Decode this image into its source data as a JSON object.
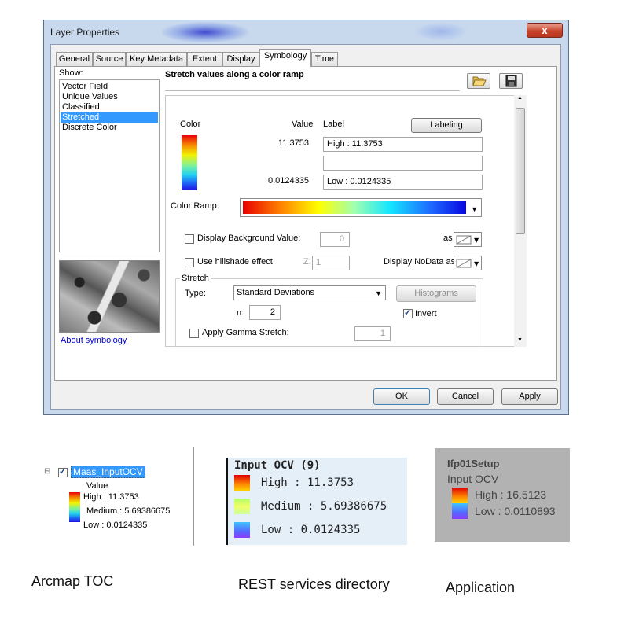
{
  "dialog": {
    "title": "Layer Properties",
    "close_glyph": "x",
    "tabs": [
      "General",
      "Source",
      "Key Metadata",
      "Extent",
      "Display",
      "Symbology",
      "Time"
    ],
    "active_tab": "Symbology",
    "show_label": "Show:",
    "show_items": [
      "Vector Field",
      "Unique Values",
      "Classified",
      "Stretched",
      "Discrete Color"
    ],
    "selected_show_item": "Stretched",
    "about_link": "About symbology",
    "subheading": "Stretch values along a color ramp",
    "columns": {
      "color": "Color",
      "value": "Value",
      "label": "Label"
    },
    "labeling_button": "Labeling",
    "high_value": "11.3753",
    "high_label": "High : 11.3753",
    "mid_label": "",
    "low_value": "0.0124335",
    "low_label": "Low : 0.0124335",
    "color_ramp_label": "Color Ramp:",
    "display_background_label": "Display Background Value:",
    "display_background_value": "0",
    "as_label": "as",
    "hillshade_label": "Use hillshade effect",
    "z_label": "Z:",
    "z_value": "1",
    "nodata_label": "Display NoData as",
    "stretch_group": "Stretch",
    "type_label": "Type:",
    "type_value": "Standard Deviations",
    "histograms_button": "Histograms",
    "n_label": "n:",
    "n_value": "2",
    "invert_label": "Invert",
    "invert_checked": true,
    "gamma_label": "Apply Gamma Stretch:",
    "gamma_value": "1",
    "ok_button": "OK",
    "cancel_button": "Cancel",
    "apply_button": "Apply"
  },
  "toc": {
    "expander": "⊟",
    "layer_name": "Maas_InputOCV",
    "layer_checked": true,
    "value_header": "Value",
    "high": "High : 11.3753",
    "medium": "Medium : 5.69386675",
    "low": "Low : 0.0124335"
  },
  "rest": {
    "title": "Input OCV (9)",
    "high": "High : 11.3753",
    "medium": "Medium : 5.69386675",
    "low": "Low : 0.0124335"
  },
  "app": {
    "title": "Ifp01Setup",
    "subtitle": "Input OCV",
    "high": "High : 16.5123",
    "low": "Low : 0.0110893"
  },
  "captions": {
    "toc": "Arcmap TOC",
    "rest": "REST services directory",
    "app": "Application"
  },
  "colors": {
    "dialog_frame": "#c8d9ee",
    "selection": "#3399ff",
    "rest_background": "#e5eff8",
    "app_background": "#b2b2b2"
  }
}
